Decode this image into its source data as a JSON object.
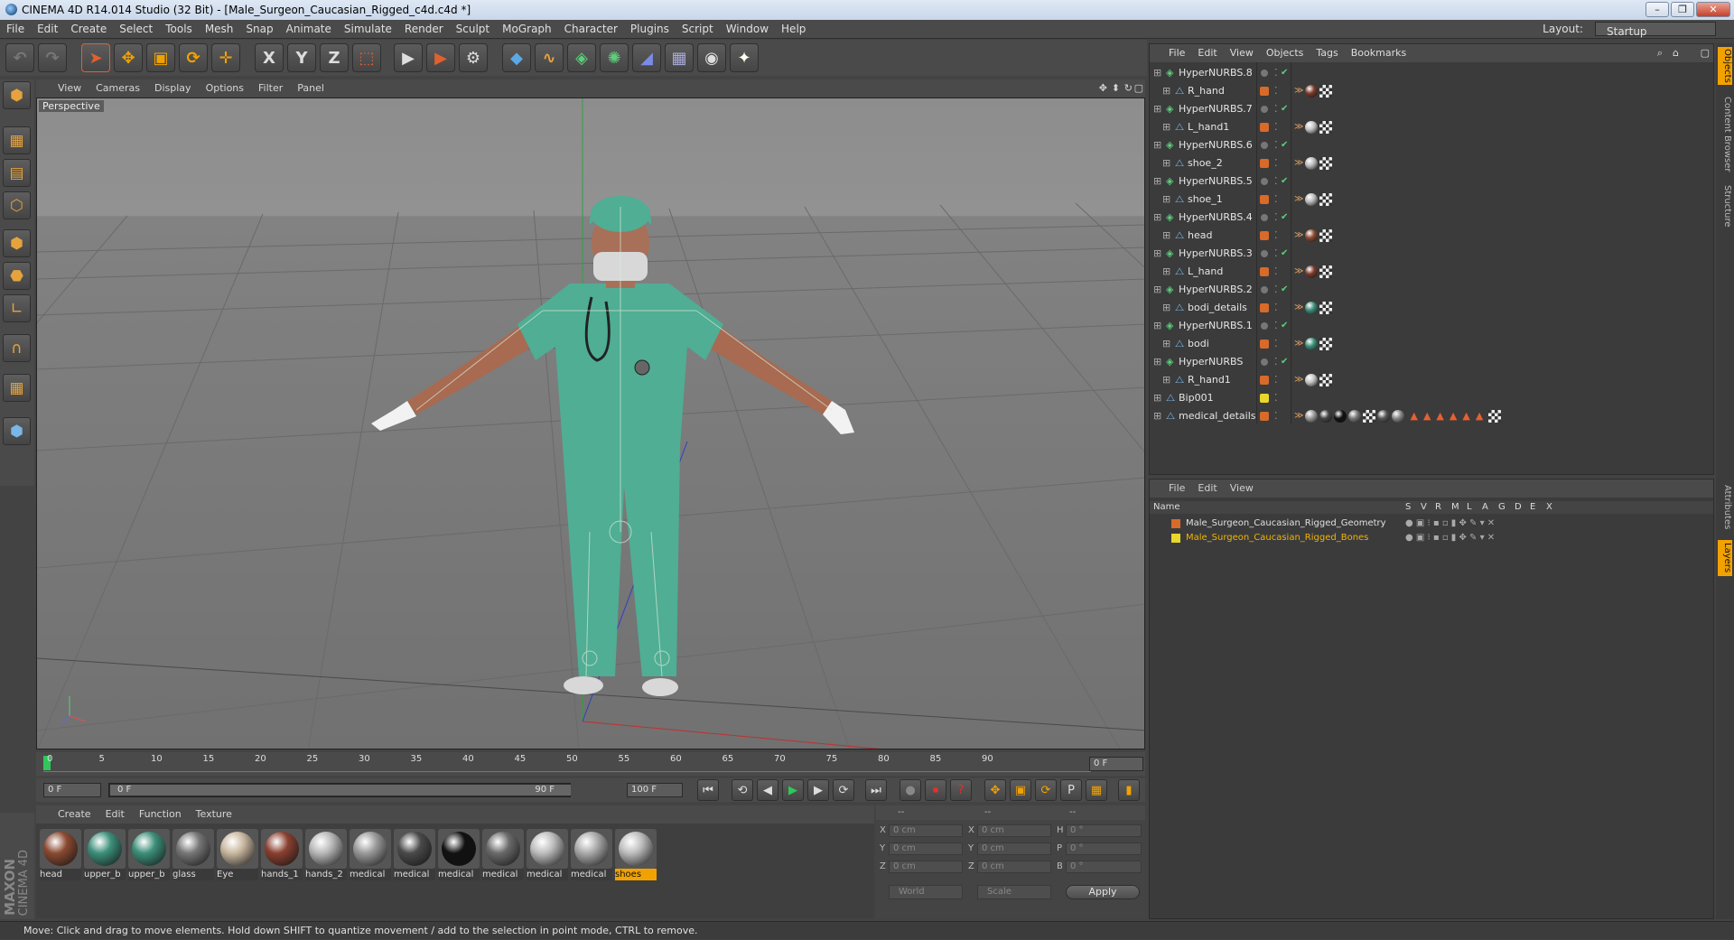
{
  "window": {
    "title": "CINEMA 4D R14.014 Studio (32 Bit) - [Male_Surgeon_Caucasian_Rigged_c4d.c4d *]",
    "minimize": "–",
    "restore": "❐",
    "close": "✕"
  },
  "menu": [
    "File",
    "Edit",
    "Create",
    "Select",
    "Tools",
    "Mesh",
    "Snap",
    "Animate",
    "Simulate",
    "Render",
    "Sculpt",
    "MoGraph",
    "Character",
    "Plugins",
    "Script",
    "Window",
    "Help"
  ],
  "layout": {
    "label": "Layout:",
    "value": "Startup"
  },
  "toolbar": {
    "undo": "↶",
    "redo": "↷",
    "select": "➤",
    "move": "✥",
    "scale": "▣",
    "rotate": "⟳",
    "new_obj": "✛",
    "x": "X",
    "y": "Y",
    "z": "Z",
    "coord": "⬚",
    "render_view": "▶",
    "render_pic": "▶",
    "render_settings": "⚙",
    "cube": "◆",
    "spline": "∿",
    "nurbs": "◈",
    "array": "✺",
    "deformer": "◢",
    "floor": "▦",
    "camera": "◉",
    "light": "✦"
  },
  "left_tools": [
    "⬢",
    "▦",
    "▤",
    "⬡",
    "⬢",
    "⬣",
    "∟",
    "∩",
    "▦",
    "⬢"
  ],
  "viewport": {
    "menu": [
      "View",
      "Cameras",
      "Display",
      "Options",
      "Filter",
      "Panel"
    ],
    "label": "Perspective",
    "nav_icons": [
      "✥",
      "⬍",
      "↻",
      "▢"
    ]
  },
  "timeline": {
    "ticks": [
      "0",
      "5",
      "10",
      "15",
      "20",
      "25",
      "30",
      "35",
      "40",
      "45",
      "50",
      "55",
      "60",
      "65",
      "70",
      "75",
      "80",
      "85",
      "90"
    ],
    "current": "0 F"
  },
  "frames": {
    "start": "0 F",
    "range_start": "0 F",
    "range_end": "90 F",
    "end": "100 F"
  },
  "playback": {
    "first": "⏮",
    "prev_key": "⟲",
    "prev": "◀",
    "play": "▶",
    "next": "▶",
    "next_key": "⟳",
    "last": "⏭",
    "rec": "●",
    "auto": "⏺",
    "keyhelp": "?",
    "move": "✥",
    "scale": "▣",
    "rotate": "⟳",
    "param": "P",
    "pla": "▦",
    "timeline": "▮"
  },
  "materials": {
    "menu": [
      "Create",
      "Edit",
      "Function",
      "Texture"
    ],
    "items": [
      {
        "label": "head",
        "color": "#8a4a32"
      },
      {
        "label": "upper_b",
        "color": "#3d8f7a"
      },
      {
        "label": "upper_b",
        "color": "#3d8f7a"
      },
      {
        "label": "glass",
        "color": "#777777"
      },
      {
        "label": "Eye",
        "color": "#c9b8a0"
      },
      {
        "label": "hands_1",
        "color": "#8a4030"
      },
      {
        "label": "hands_2",
        "color": "#b8b8b8"
      },
      {
        "label": "medical",
        "color": "#9a9a9a"
      },
      {
        "label": "medical",
        "color": "#4a4a4a"
      },
      {
        "label": "medical",
        "color": "#111111"
      },
      {
        "label": "medical",
        "color": "#6a6a6a"
      },
      {
        "label": "medical",
        "color": "#bdbdbd"
      },
      {
        "label": "medical",
        "color": "#aaaaaa"
      },
      {
        "label": "shoes",
        "color": "#bdbdbd",
        "selected": true
      }
    ]
  },
  "brand": {
    "line1": "MAXON",
    "line2": "CINEMA 4D"
  },
  "coords": {
    "header": [
      "--",
      "--",
      "--"
    ],
    "rows": [
      {
        "a": "X",
        "av": "0 cm",
        "b": "X",
        "bv": "0 cm",
        "c": "H",
        "cv": "0 °"
      },
      {
        "a": "Y",
        "av": "0 cm",
        "b": "Y",
        "bv": "0 cm",
        "c": "P",
        "cv": "0 °"
      },
      {
        "a": "Z",
        "av": "0 cm",
        "b": "Z",
        "bv": "0 cm",
        "c": "B",
        "cv": "0 °"
      }
    ],
    "world": "World",
    "scale": "Scale",
    "apply": "Apply"
  },
  "objects": {
    "menu": [
      "File",
      "Edit",
      "View",
      "Objects",
      "Tags",
      "Bookmarks"
    ],
    "rows": [
      {
        "name": "HyperNURBS.8",
        "indent": 0,
        "color": "",
        "check": true,
        "tags": []
      },
      {
        "name": "R_hand",
        "indent": 1,
        "color": "#d86a2a",
        "check": false,
        "tags": [
          "#7a3b2b",
          "#ddd"
        ]
      },
      {
        "name": "HyperNURBS.7",
        "indent": 0,
        "color": "",
        "check": true,
        "tags": []
      },
      {
        "name": "L_hand1",
        "indent": 1,
        "color": "#d86a2a",
        "check": false,
        "tags": [
          "#c4c4c4",
          "#ddd"
        ]
      },
      {
        "name": "HyperNURBS.6",
        "indent": 0,
        "color": "",
        "check": true,
        "tags": []
      },
      {
        "name": "shoe_2",
        "indent": 1,
        "color": "#d86a2a",
        "check": false,
        "tags": [
          "#bbbbbb",
          "#ddd"
        ]
      },
      {
        "name": "HyperNURBS.5",
        "indent": 0,
        "color": "",
        "check": true,
        "tags": []
      },
      {
        "name": "shoe_1",
        "indent": 1,
        "color": "#d86a2a",
        "check": false,
        "tags": [
          "#bbbbbb",
          "#ddd"
        ]
      },
      {
        "name": "HyperNURBS.4",
        "indent": 0,
        "color": "",
        "check": true,
        "tags": []
      },
      {
        "name": "head",
        "indent": 1,
        "color": "#d86a2a",
        "check": false,
        "tags": [
          "#8a4a32",
          "#ddd"
        ]
      },
      {
        "name": "HyperNURBS.3",
        "indent": 0,
        "color": "",
        "check": true,
        "tags": []
      },
      {
        "name": "L_hand",
        "indent": 1,
        "color": "#d86a2a",
        "check": false,
        "tags": [
          "#7a3b2b",
          "#ddd"
        ]
      },
      {
        "name": "HyperNURBS.2",
        "indent": 0,
        "color": "",
        "check": true,
        "tags": []
      },
      {
        "name": "bodi_details",
        "indent": 1,
        "color": "#d86a2a",
        "check": false,
        "tags": [
          "#3d8f7a",
          "#ddd"
        ]
      },
      {
        "name": "HyperNURBS.1",
        "indent": 0,
        "color": "",
        "check": true,
        "tags": []
      },
      {
        "name": "bodi",
        "indent": 1,
        "color": "#d86a2a",
        "check": false,
        "tags": [
          "#3d8f7a",
          "#ddd"
        ]
      },
      {
        "name": "HyperNURBS",
        "indent": 0,
        "color": "",
        "check": true,
        "tags": []
      },
      {
        "name": "R_hand1",
        "indent": 1,
        "color": "#d86a2a",
        "check": false,
        "tags": [
          "#c4c4c4",
          "#ddd"
        ]
      },
      {
        "name": "Bip001",
        "indent": 0,
        "color": "#e8d82a",
        "check": false,
        "tags": []
      },
      {
        "name": "medical_details",
        "indent": 0,
        "color": "#d86a2a",
        "check": false,
        "tags": [
          "#999",
          "#444",
          "#111",
          "#777",
          "#ddd",
          "#555",
          "#888"
        ]
      }
    ]
  },
  "layers": {
    "menu": [
      "File",
      "Edit",
      "View"
    ],
    "columns": [
      "Name",
      "S",
      "V",
      "R",
      "M",
      "L",
      "A",
      "G",
      "D",
      "E",
      "X"
    ],
    "rows": [
      {
        "name": "Male_Surgeon_Caucasian_Rigged_Geometry",
        "color": "#d86a2a",
        "text": "#e0e0e0"
      },
      {
        "name": "Male_Surgeon_Caucasian_Rigged_Bones",
        "color": "#e8d82a",
        "text": "#f0b400"
      }
    ]
  },
  "side_tabs": [
    "Objects",
    "Content Browser",
    "Structure",
    "Attributes",
    "Layers"
  ],
  "status": "Move: Click and drag to move elements. Hold down SHIFT to quantize movement / add to the selection in point mode, CTRL to remove.",
  "colors": {
    "accent": "#f2a200",
    "scrubs": "#4fae94",
    "ui_bg": "#4a4a4a"
  }
}
